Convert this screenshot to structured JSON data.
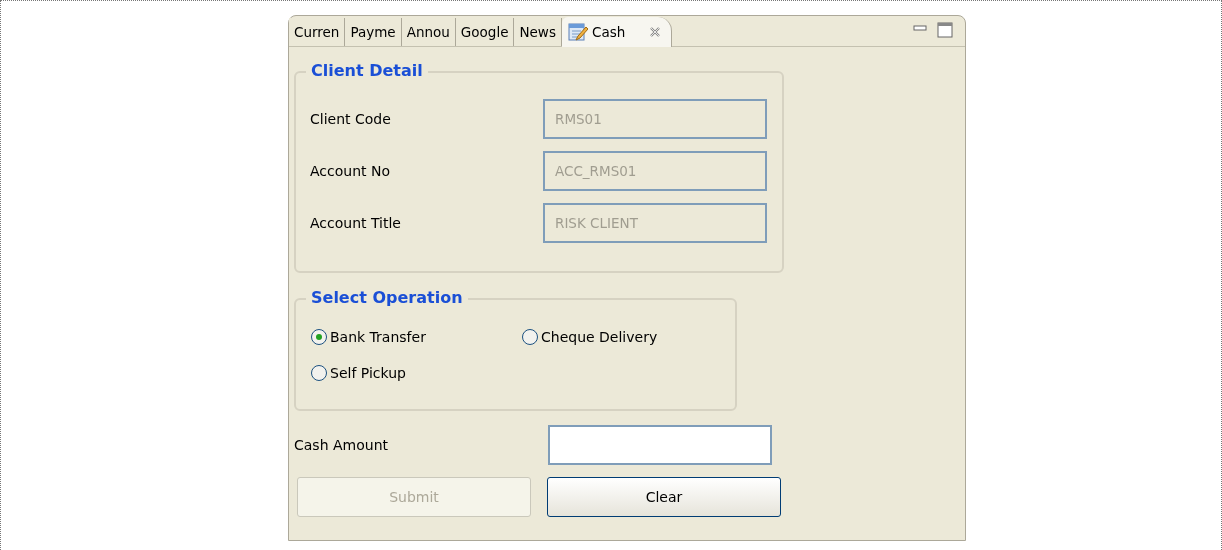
{
  "tabs": [
    {
      "label": "Curren",
      "selected": false
    },
    {
      "label": "Payme",
      "selected": false
    },
    {
      "label": "Annou",
      "selected": false
    },
    {
      "label": "Google",
      "selected": false
    },
    {
      "label": "News",
      "selected": false
    },
    {
      "label": "Cash",
      "selected": true
    }
  ],
  "client_detail": {
    "title": "Client Detail",
    "fields": [
      {
        "label": "Client Code",
        "value": "RMS01",
        "disabled": true
      },
      {
        "label": "Account No",
        "value": "ACC_RMS01",
        "disabled": true
      },
      {
        "label": "Account Title",
        "value": "RISK CLIENT",
        "disabled": true
      }
    ]
  },
  "select_operation": {
    "title": "Select Operation",
    "options": [
      {
        "label": "Bank Transfer",
        "selected": true
      },
      {
        "label": "Cheque Delivery",
        "selected": false
      },
      {
        "label": "Self Pickup",
        "selected": false
      }
    ]
  },
  "cash_amount": {
    "label": "Cash Amount"
  },
  "buttons": [
    {
      "label": "Submit",
      "disabled": true
    },
    {
      "label": "Clear",
      "disabled": false
    }
  ]
}
